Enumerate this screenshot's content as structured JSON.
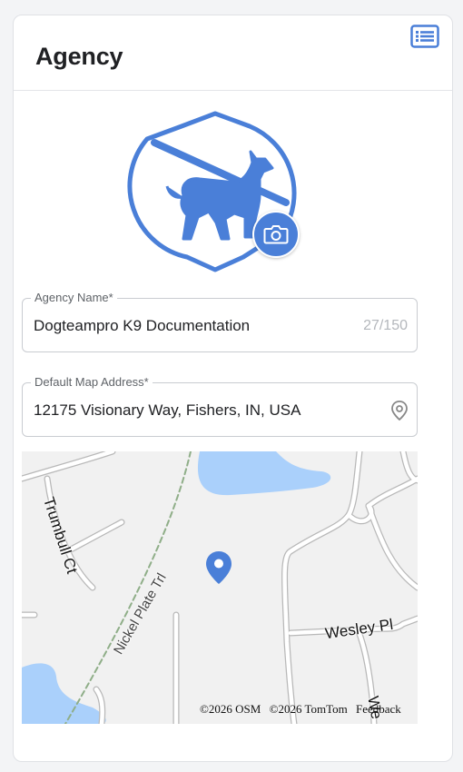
{
  "page": {
    "title": "Agency"
  },
  "colors": {
    "accent": "#4a7fd8",
    "water": "#aad0fb",
    "trail": "#8fae88"
  },
  "icons": {
    "list": "list-icon",
    "camera": "camera-icon",
    "location": "location-pin-icon",
    "logo": "k9-badge-logo",
    "map_marker": "map-marker-icon"
  },
  "agency_name": {
    "label": "Agency Name*",
    "value": "Dogteampro K9 Documentation",
    "counter": "27/150"
  },
  "map_address": {
    "label": "Default Map Address*",
    "value": "12175 Visionary Way, Fishers, IN, USA"
  },
  "map": {
    "streets": [
      "Trumbull Ct",
      "Nickel Plate Trl",
      "Wesley Pl",
      "We"
    ],
    "attribution": [
      "©2026 OSM",
      "©2026 TomTom",
      "Feedback"
    ]
  }
}
